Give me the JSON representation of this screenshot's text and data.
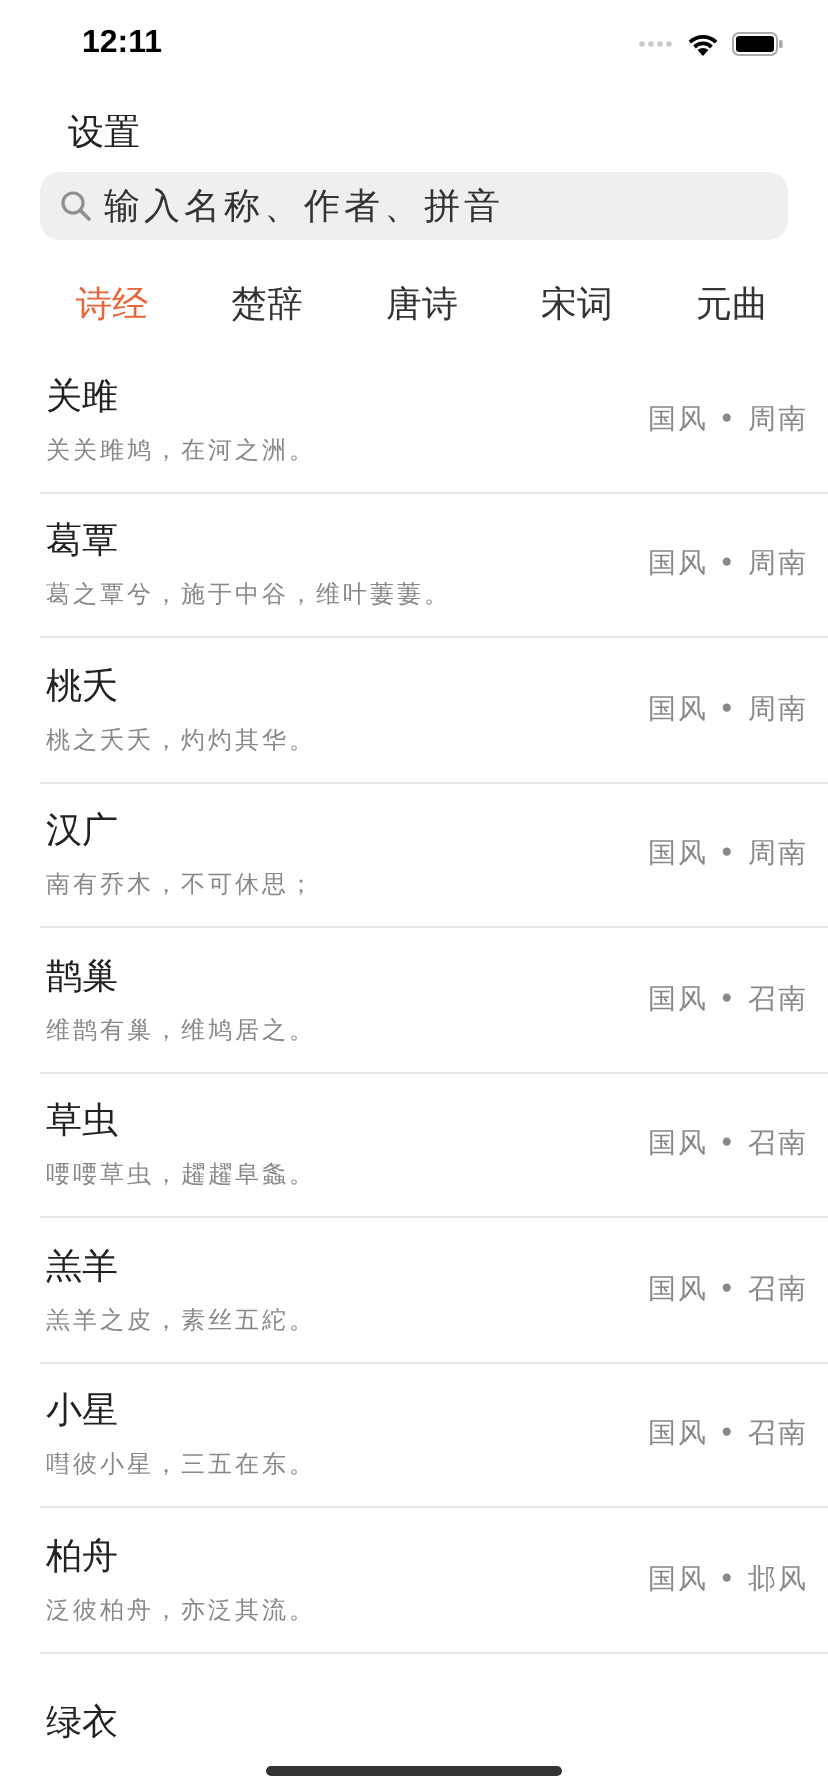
{
  "status_bar": {
    "time": "12:11"
  },
  "header": {
    "title": "设置"
  },
  "search": {
    "placeholder": "输入名称、作者、拼音"
  },
  "tabs": [
    {
      "label": "诗经",
      "selected": true
    },
    {
      "label": "楚辞",
      "selected": false
    },
    {
      "label": "唐诗",
      "selected": false
    },
    {
      "label": "宋词",
      "selected": false
    },
    {
      "label": "元曲",
      "selected": false
    }
  ],
  "poems": [
    {
      "title": "关雎",
      "line": "关关雎鸠，在河之洲。",
      "tag": "国风 • 周南"
    },
    {
      "title": "葛覃",
      "line": "葛之覃兮，施于中谷，维叶萋萋。",
      "tag": "国风 • 周南"
    },
    {
      "title": "桃夭",
      "line": "桃之夭夭，灼灼其华。",
      "tag": "国风 • 周南"
    },
    {
      "title": "汉广",
      "line": "南有乔木，不可休思；",
      "tag": "国风 • 周南"
    },
    {
      "title": "鹊巢",
      "line": "维鹊有巢，维鸠居之。",
      "tag": "国风 • 召南"
    },
    {
      "title": "草虫",
      "line": "喓喓草虫，趯趯阜螽。",
      "tag": "国风 • 召南"
    },
    {
      "title": "羔羊",
      "line": "羔羊之皮，素丝五紽。",
      "tag": "国风 • 召南"
    },
    {
      "title": "小星",
      "line": "嘒彼小星，三五在东。",
      "tag": "国风 • 召南"
    },
    {
      "title": "柏舟",
      "line": "泛彼柏舟，亦泛其流。",
      "tag": "国风 • 邶风"
    },
    {
      "title": "绿衣"
    }
  ]
}
